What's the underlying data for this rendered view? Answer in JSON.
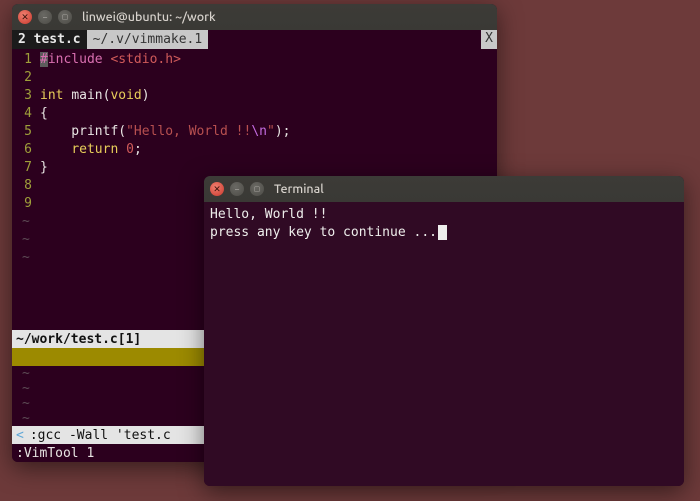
{
  "vim_window": {
    "title": "linwei@ubuntu: ~/work",
    "tabs": {
      "active_index": "2",
      "active_label": "test.c",
      "inactive_label": "~/.v/vimmake.1",
      "close_glyph": "X"
    },
    "code": {
      "l1_gutter": "1",
      "l1_hash": "#",
      "l1_pp": "include ",
      "l1_inc": "<stdio.h>",
      "l2_gutter": "2",
      "l3_gutter": "3",
      "l3_kw": "int ",
      "l3_rest1": "main(",
      "l3_kw2": "void",
      "l3_rest2": ")",
      "l4_gutter": "4",
      "l4_txt": "{",
      "l5_gutter": "5",
      "l5_indent": "    printf(",
      "l5_str1": "\"Hello, World !!",
      "l5_esc": "\\n",
      "l5_str2": "\"",
      "l5_end": ");",
      "l6_gutter": "6",
      "l6_indent": "    ",
      "l6_kw": "return ",
      "l6_num": "0",
      "l6_end": ";",
      "l7_gutter": "7",
      "l7_txt": "}",
      "l8_gutter": "8",
      "l9_gutter": "9",
      "tilde": "~"
    },
    "statusline": "~/work/test.c[1]",
    "quickfix_truncmark": "<",
    "quickfix_status": ":gcc -Wall 'test.c",
    "cmdline": ":VimTool 1"
  },
  "terminal_window": {
    "title": "Terminal",
    "line1": "Hello, World !!",
    "line2": "press any key to continue ..."
  }
}
